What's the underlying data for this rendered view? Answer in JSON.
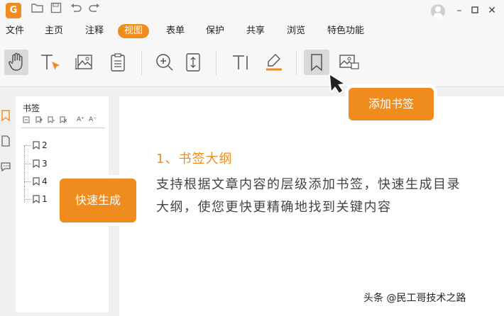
{
  "titlebar": {
    "logo_text": "G",
    "quick_access": [
      "folder-open-icon",
      "save-icon",
      "undo-icon",
      "redo-icon"
    ],
    "window_controls": [
      "minimize-icon",
      "maximize-icon",
      "close-icon"
    ]
  },
  "menu": {
    "items": [
      "文件",
      "主页",
      "注释",
      "视图",
      "表单",
      "保护",
      "共享",
      "浏览",
      "特色功能"
    ],
    "active": "视图"
  },
  "toolbar": {
    "tools": [
      "hand-icon",
      "select-text-icon",
      "snapshot-icon",
      "clipboard-icon",
      "zoom-in-icon",
      "fit-page-icon",
      "typewriter-icon",
      "highlight-icon",
      "bookmark-icon",
      "image-icon"
    ],
    "selected": "bookmark-icon"
  },
  "sidebar": {
    "icons": [
      "bookmark-tab-icon",
      "pages-tab-icon",
      "comments-tab-icon"
    ]
  },
  "panel": {
    "title": "书签",
    "tools": [
      "expand-icon",
      "add-bookmark-icon",
      "add-child-icon",
      "delete-bookmark-icon",
      "font-larger-icon",
      "font-smaller-icon"
    ],
    "font_up": "A⁺",
    "font_down": "A⁻",
    "bookmarks": [
      "2",
      "3",
      "4",
      "1"
    ]
  },
  "document": {
    "heading": "1、书签大纲",
    "body": "支持根据文章内容的层级添加书签，快速生成目录大纲，使您更快更精确地找到关键内容"
  },
  "callouts": {
    "add_bookmark": "添加书签",
    "quick_generate": "快速生成"
  },
  "watermark": "头条 @民工哥技术之路",
  "colors": {
    "accent": "#f08c1e",
    "page": "#ffffff",
    "background": "#f0f0f0"
  }
}
